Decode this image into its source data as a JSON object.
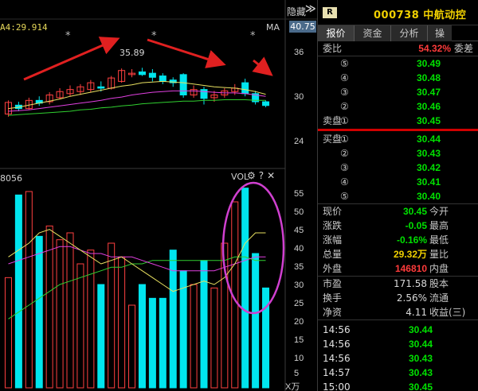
{
  "chart": {
    "hide_label": "隐藏",
    "collapse_glyph": "≫",
    "ma_label": "A4:29.914",
    "ma_right": "MA",
    "current_price": "40.75",
    "peak_label": "35.89",
    "y_labels": [
      "36",
      "30",
      "24"
    ],
    "volume": {
      "left_label": "8056",
      "title": "VOL",
      "icons": [
        "gear-icon",
        "help-icon",
        "close-icon"
      ],
      "y_labels": [
        "55",
        "50",
        "45",
        "40",
        "35",
        "30",
        "25",
        "20",
        "15",
        "10",
        "5",
        "X万"
      ]
    },
    "colors": {
      "up": "#ff4040",
      "down": "#00e5ee",
      "ma_yellow": "#e8e060",
      "ma_magenta": "#e040e0",
      "ma_green": "#30d030",
      "annotation": "#e02020",
      "circle": "#d040d0"
    }
  },
  "stock": {
    "badge": "R",
    "code_name": "000738 中航动控"
  },
  "tabs": [
    "报价",
    "资金",
    "分析",
    "操"
  ],
  "order_book": {
    "webi_label": "委比",
    "webi_value": "54.32%",
    "weicha_label": "委差",
    "sell": [
      {
        "label": "",
        "level": "⑤",
        "price": "30.49"
      },
      {
        "label": "",
        "level": "④",
        "price": "30.48"
      },
      {
        "label": "",
        "level": "③",
        "price": "30.47"
      },
      {
        "label": "",
        "level": "②",
        "price": "30.46"
      },
      {
        "label": "卖盘",
        "level": "①",
        "price": "30.45"
      }
    ],
    "buy": [
      {
        "label": "买盘",
        "level": "①",
        "price": "30.44"
      },
      {
        "label": "",
        "level": "②",
        "price": "30.43"
      },
      {
        "label": "",
        "level": "③",
        "price": "30.42"
      },
      {
        "label": "",
        "level": "④",
        "price": "30.41"
      },
      {
        "label": "",
        "level": "⑤",
        "price": "30.40"
      }
    ]
  },
  "quote": [
    {
      "l1": "现价",
      "v1": "30.45",
      "l2": "今开"
    },
    {
      "l1": "涨跌",
      "v1": "-0.05",
      "l2": "最高"
    },
    {
      "l1": "涨幅",
      "v1": "-0.16%",
      "l2": "最低"
    },
    {
      "l1": "总量",
      "v1": "29.32万",
      "l2": "量比"
    },
    {
      "l1": "外盘",
      "v1": "146810",
      "l2": "内盘"
    }
  ],
  "stats": [
    {
      "l1": "市盈",
      "v1": "171.58",
      "l2": "股本"
    },
    {
      "l1": "换手",
      "v1": "2.56%",
      "l2": "流通"
    },
    {
      "l1": "净资",
      "v1": "4.11",
      "l2": "收益(三)"
    }
  ],
  "ticks": [
    {
      "time": "14:56",
      "price": "30.44"
    },
    {
      "time": "14:56",
      "price": "30.44"
    },
    {
      "time": "14:56",
      "price": "30.43"
    },
    {
      "time": "14:57",
      "price": "30.43"
    },
    {
      "time": "15:00",
      "price": "30.45"
    }
  ],
  "chart_data": {
    "type": "candlestick",
    "price_range": [
      22,
      42
    ],
    "volume_range": [
      0,
      60
    ],
    "candles": [
      {
        "o": 29.2,
        "c": 30.9,
        "h": 31.2,
        "l": 28.8,
        "v": 32
      },
      {
        "o": 30.5,
        "c": 30.0,
        "h": 31.0,
        "l": 29.6,
        "v": 56
      },
      {
        "o": 30.0,
        "c": 31.2,
        "h": 31.6,
        "l": 29.8,
        "v": 57
      },
      {
        "o": 31.2,
        "c": 30.8,
        "h": 31.8,
        "l": 30.4,
        "v": 44
      },
      {
        "o": 31.0,
        "c": 32.0,
        "h": 32.4,
        "l": 30.6,
        "v": 47
      },
      {
        "o": 31.6,
        "c": 32.5,
        "h": 33.0,
        "l": 31.4,
        "v": 43
      },
      {
        "o": 32.2,
        "c": 32.8,
        "h": 33.4,
        "l": 31.8,
        "v": 45
      },
      {
        "o": 32.5,
        "c": 33.2,
        "h": 33.6,
        "l": 32.0,
        "v": 36
      },
      {
        "o": 32.8,
        "c": 33.8,
        "h": 34.2,
        "l": 32.4,
        "v": 40
      },
      {
        "o": 33.2,
        "c": 33.0,
        "h": 34.0,
        "l": 32.5,
        "v": 30
      },
      {
        "o": 33.0,
        "c": 34.5,
        "h": 34.8,
        "l": 32.8,
        "v": 42
      },
      {
        "o": 34.0,
        "c": 35.6,
        "h": 35.9,
        "l": 33.8,
        "v": 38
      },
      {
        "o": 35.0,
        "c": 35.2,
        "h": 35.8,
        "l": 34.6,
        "v": 24
      },
      {
        "o": 35.4,
        "c": 35.0,
        "h": 36.0,
        "l": 34.8,
        "v": 30
      },
      {
        "o": 35.2,
        "c": 34.6,
        "h": 35.8,
        "l": 34.0,
        "v": 26
      },
      {
        "o": 34.8,
        "c": 34.0,
        "h": 35.2,
        "l": 33.6,
        "v": 26
      },
      {
        "o": 34.2,
        "c": 33.8,
        "h": 34.6,
        "l": 33.2,
        "v": 40
      },
      {
        "o": 35.0,
        "c": 32.0,
        "h": 35.2,
        "l": 31.6,
        "v": 34
      },
      {
        "o": 32.0,
        "c": 32.8,
        "h": 33.4,
        "l": 31.6,
        "v": 30
      },
      {
        "o": 32.8,
        "c": 31.5,
        "h": 33.2,
        "l": 30.6,
        "v": 37
      },
      {
        "o": 31.6,
        "c": 32.0,
        "h": 32.6,
        "l": 31.0,
        "v": 29
      },
      {
        "o": 32.0,
        "c": 32.6,
        "h": 33.0,
        "l": 31.6,
        "v": 42
      },
      {
        "o": 32.5,
        "c": 33.0,
        "h": 33.6,
        "l": 32.0,
        "v": 54
      },
      {
        "o": 33.8,
        "c": 32.2,
        "h": 34.4,
        "l": 31.8,
        "v": 58
      },
      {
        "o": 32.2,
        "c": 31.0,
        "h": 32.6,
        "l": 30.6,
        "v": 39
      },
      {
        "o": 31.0,
        "c": 30.45,
        "h": 31.2,
        "l": 30.2,
        "v": 29
      }
    ],
    "ma_price": {
      "ma_yellow": [
        30.0,
        30.2,
        30.5,
        30.8,
        31.1,
        31.4,
        31.8,
        32.1,
        32.4,
        32.7,
        33.0,
        33.3,
        33.5,
        33.8,
        33.9,
        34.0,
        33.9,
        33.8,
        33.6,
        33.4,
        33.2,
        33.1,
        33.0,
        32.8,
        32.5,
        32.1
      ],
      "ma_magenta": [
        29.6,
        29.7,
        29.8,
        30.0,
        30.2,
        30.4,
        30.6,
        30.8,
        31.0,
        31.2,
        31.5,
        31.7,
        32.0,
        32.2,
        32.4,
        32.5,
        32.6,
        32.6,
        32.6,
        32.5,
        32.4,
        32.3,
        32.3,
        32.2,
        32.0,
        31.8
      ],
      "ma_green": [
        29.0,
        29.1,
        29.2,
        29.3,
        29.4,
        29.5,
        29.6,
        29.8,
        29.9,
        30.1,
        30.2,
        30.4,
        30.5,
        30.7,
        30.8,
        30.9,
        31.0,
        31.1,
        31.1,
        31.2,
        31.2,
        31.3,
        31.3,
        31.3,
        31.2,
        31.2
      ]
    },
    "ma_volume": {
      "ma_yellow": [
        38,
        40,
        42,
        45,
        46,
        44,
        42,
        40,
        38,
        36,
        37,
        38,
        36,
        34,
        32,
        30,
        28,
        29,
        30,
        31,
        30,
        32,
        36,
        42,
        45,
        45
      ],
      "ma_magenta": [
        36,
        37,
        38,
        39,
        40,
        41,
        41,
        40,
        39,
        39,
        38,
        38,
        38,
        37,
        36,
        35,
        34,
        34,
        34,
        34,
        34,
        35,
        36,
        37,
        38,
        38
      ],
      "ma_green": [
        20,
        22,
        24,
        26,
        28,
        30,
        31,
        32,
        33,
        34,
        35,
        35,
        36,
        36,
        37,
        37,
        37,
        37,
        37,
        37,
        37,
        37,
        38,
        38,
        37,
        37
      ]
    }
  }
}
